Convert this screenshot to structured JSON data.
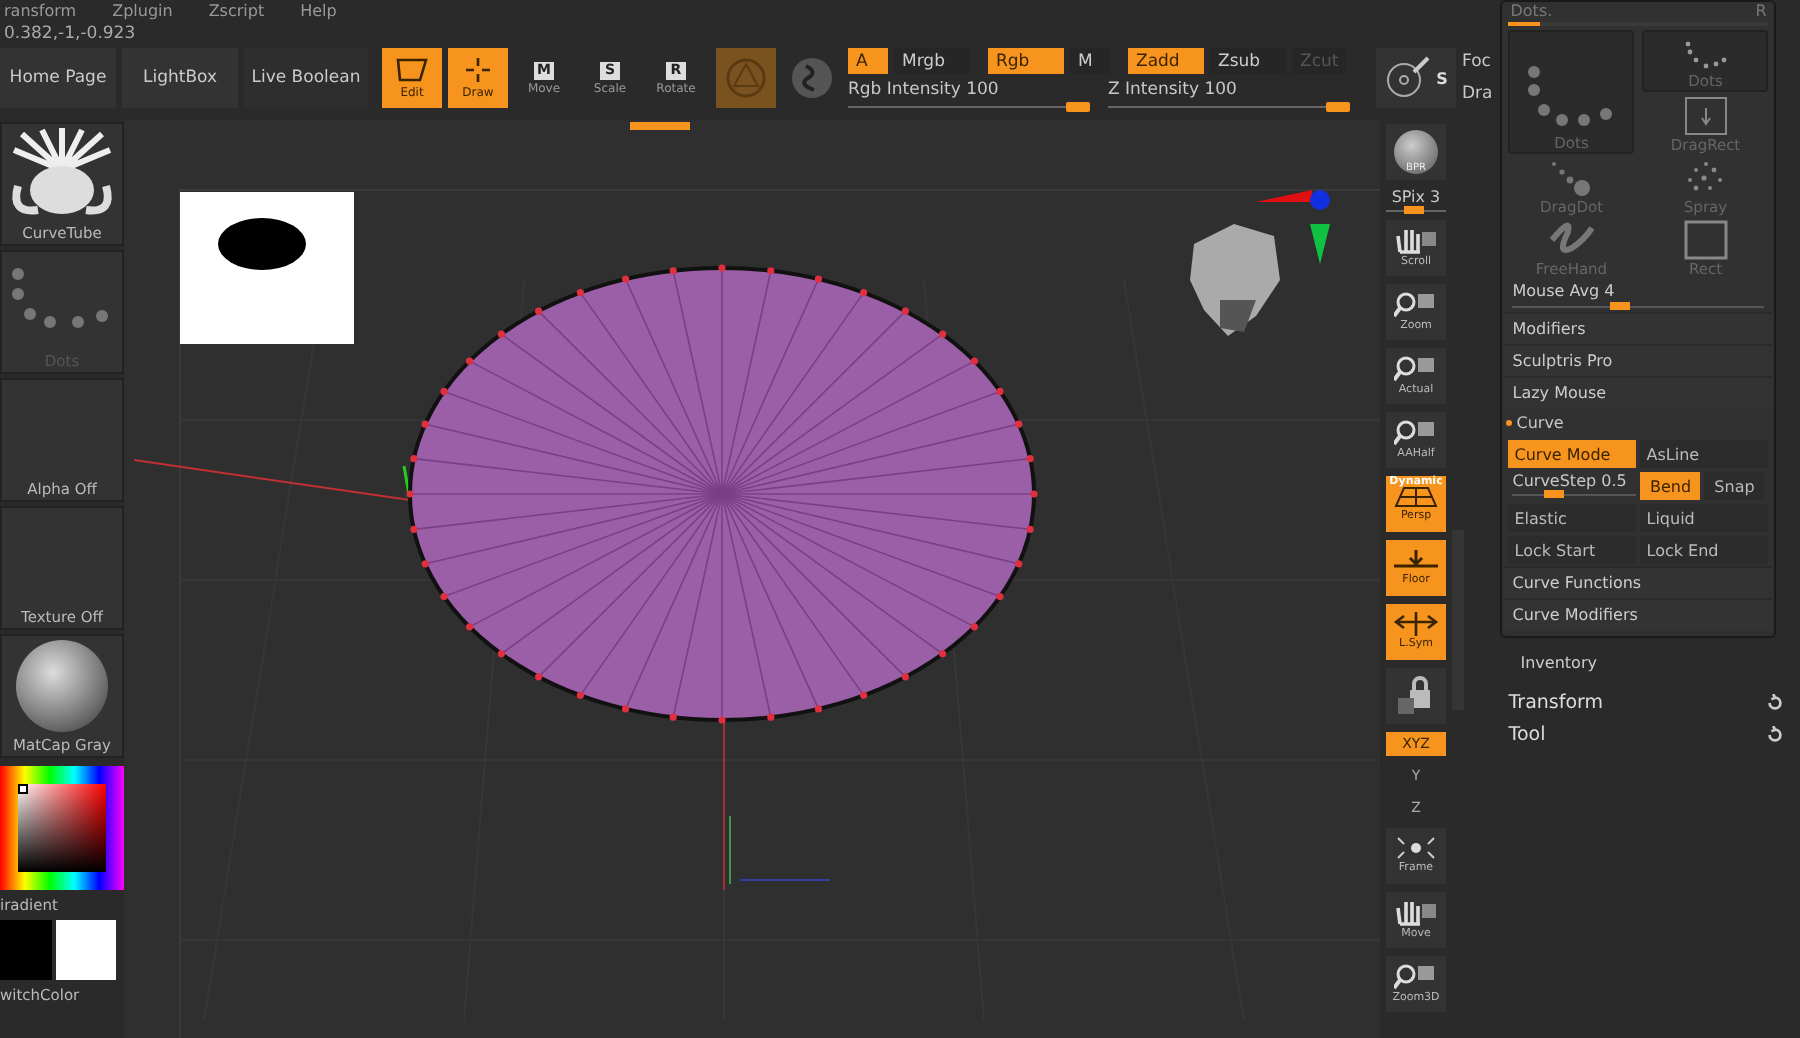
{
  "menu": [
    "ransform",
    "Zplugin",
    "Zscript",
    "Help"
  ],
  "coordinates": "0.382,-1,-0.923",
  "quick_buttons": [
    {
      "label": "Home Page"
    },
    {
      "label": "LightBox"
    },
    {
      "label": "Live Boolean"
    }
  ],
  "tools": [
    {
      "label": "Edit",
      "kind": "edit",
      "selected": true
    },
    {
      "label": "Draw",
      "kind": "draw",
      "selected": true
    },
    {
      "label": "Move",
      "key": "M",
      "kind": "move",
      "selected": false
    },
    {
      "label": "Scale",
      "key": "S",
      "kind": "scale",
      "selected": false
    },
    {
      "label": "Rotate",
      "key": "R",
      "kind": "rotate",
      "selected": false
    }
  ],
  "color_modes": [
    {
      "label": "A",
      "selected": true
    },
    {
      "label": "Mrgb",
      "selected": false
    },
    {
      "label": "Rgb",
      "selected": true
    },
    {
      "label": "M",
      "selected": false
    }
  ],
  "depth_modes": [
    {
      "label": "Zadd",
      "selected": true,
      "disabled": false
    },
    {
      "label": "Zsub",
      "selected": false,
      "disabled": false
    },
    {
      "label": "Zcut",
      "selected": false,
      "disabled": true
    }
  ],
  "sliders": [
    {
      "label": "Rgb Intensity",
      "value": "100",
      "level": 1
    },
    {
      "label": "Z Intensity",
      "value": "100",
      "level": 1
    }
  ],
  "brush_icon_key": "S",
  "brush_side": [
    "Foc",
    "Dra"
  ],
  "left_panel": [
    {
      "label": "CurveTube",
      "kind": "brush",
      "disabled": false
    },
    {
      "label": "Dots",
      "kind": "dots",
      "disabled": true
    },
    {
      "label": "Alpha Off",
      "kind": "empty",
      "disabled": false
    },
    {
      "label": "Texture Off",
      "kind": "empty",
      "disabled": false
    },
    {
      "label": "MatCap Gray",
      "kind": "matcap",
      "disabled": false
    }
  ],
  "color_picker": {
    "label": "iradient"
  },
  "swatches": {
    "label": "witchColor"
  },
  "view_toolbar": [
    {
      "label": "BPR",
      "kind": "render"
    },
    {
      "label": "SPix 3",
      "kind": "slider",
      "level": 0.45
    },
    {
      "label": "Scroll",
      "kind": "hand",
      "selected": false
    },
    {
      "label": "Zoom",
      "kind": "zoom",
      "selected": false
    },
    {
      "label": "Actual",
      "kind": "zoom",
      "selected": false
    },
    {
      "label": "AAHalf",
      "kind": "zoom",
      "selected": false
    },
    {
      "label": "Persp",
      "caption": "Dynamic",
      "kind": "persp",
      "selected": true
    },
    {
      "label": "Floor",
      "kind": "floor",
      "selected": true
    },
    {
      "label": "L.Sym",
      "kind": "lsym",
      "selected": true
    },
    {
      "kind": "lock",
      "selected": false
    },
    {
      "label": "XYZ",
      "kind": "axis",
      "selected": true
    },
    {
      "label": "Y",
      "kind": "axis",
      "selected": false
    },
    {
      "label": "Z",
      "kind": "axis",
      "selected": false
    },
    {
      "label": "Frame",
      "kind": "frame",
      "selected": false
    },
    {
      "label": "Move",
      "kind": "hand",
      "selected": false
    },
    {
      "label": "Zoom3D",
      "kind": "zoom",
      "selected": false
    }
  ],
  "stroke_panel": {
    "title": "Dots.",
    "key": "R",
    "level": 0.12,
    "strokes": [
      {
        "label": "Dots",
        "kind": "dots-small",
        "selected": true
      },
      {
        "label": "Dots",
        "kind": "dots",
        "selected": true
      },
      {
        "label": "DragRect",
        "kind": "dragrect",
        "selected": false
      },
      {
        "label": "DragDot",
        "kind": "dragdot",
        "selected": false
      },
      {
        "label": "Spray",
        "kind": "spray",
        "selected": false
      },
      {
        "label": "FreeHand",
        "kind": "freehand",
        "selected": false
      },
      {
        "label": "Rect",
        "kind": "rect",
        "selected": false
      }
    ],
    "mouse_avg": {
      "label": "Mouse Avg",
      "value": "4",
      "level": 0.42
    },
    "rows": [
      {
        "kind": "section",
        "label": "Modifiers"
      },
      {
        "kind": "section",
        "label": "Sculptris Pro"
      },
      {
        "kind": "section",
        "label": "Lazy Mouse"
      },
      {
        "kind": "header",
        "label": "Curve",
        "expanded": true
      },
      {
        "kind": "pair",
        "items": [
          {
            "label": "Curve Mode",
            "selected": true
          },
          {
            "label": "AsLine",
            "selected": false
          }
        ]
      },
      {
        "kind": "slider",
        "label": "CurveStep",
        "value": "0.5",
        "level": 0.3,
        "items": [
          {
            "label": "Bend",
            "selected": true
          },
          {
            "label": "Snap",
            "selected": false
          }
        ]
      },
      {
        "kind": "pair",
        "items": [
          {
            "label": "Elastic",
            "selected": false
          },
          {
            "label": "Liquid",
            "selected": false
          }
        ]
      },
      {
        "kind": "pair",
        "items": [
          {
            "label": "Lock Start",
            "selected": false
          },
          {
            "label": "Lock End",
            "selected": false
          }
        ]
      },
      {
        "kind": "section",
        "label": "Curve Functions"
      },
      {
        "kind": "section",
        "label": "Curve Modifiers"
      }
    ]
  },
  "inventory": {
    "label": "Inventory",
    "items": [
      {
        "label": "Transform"
      },
      {
        "label": "Tool"
      }
    ]
  }
}
